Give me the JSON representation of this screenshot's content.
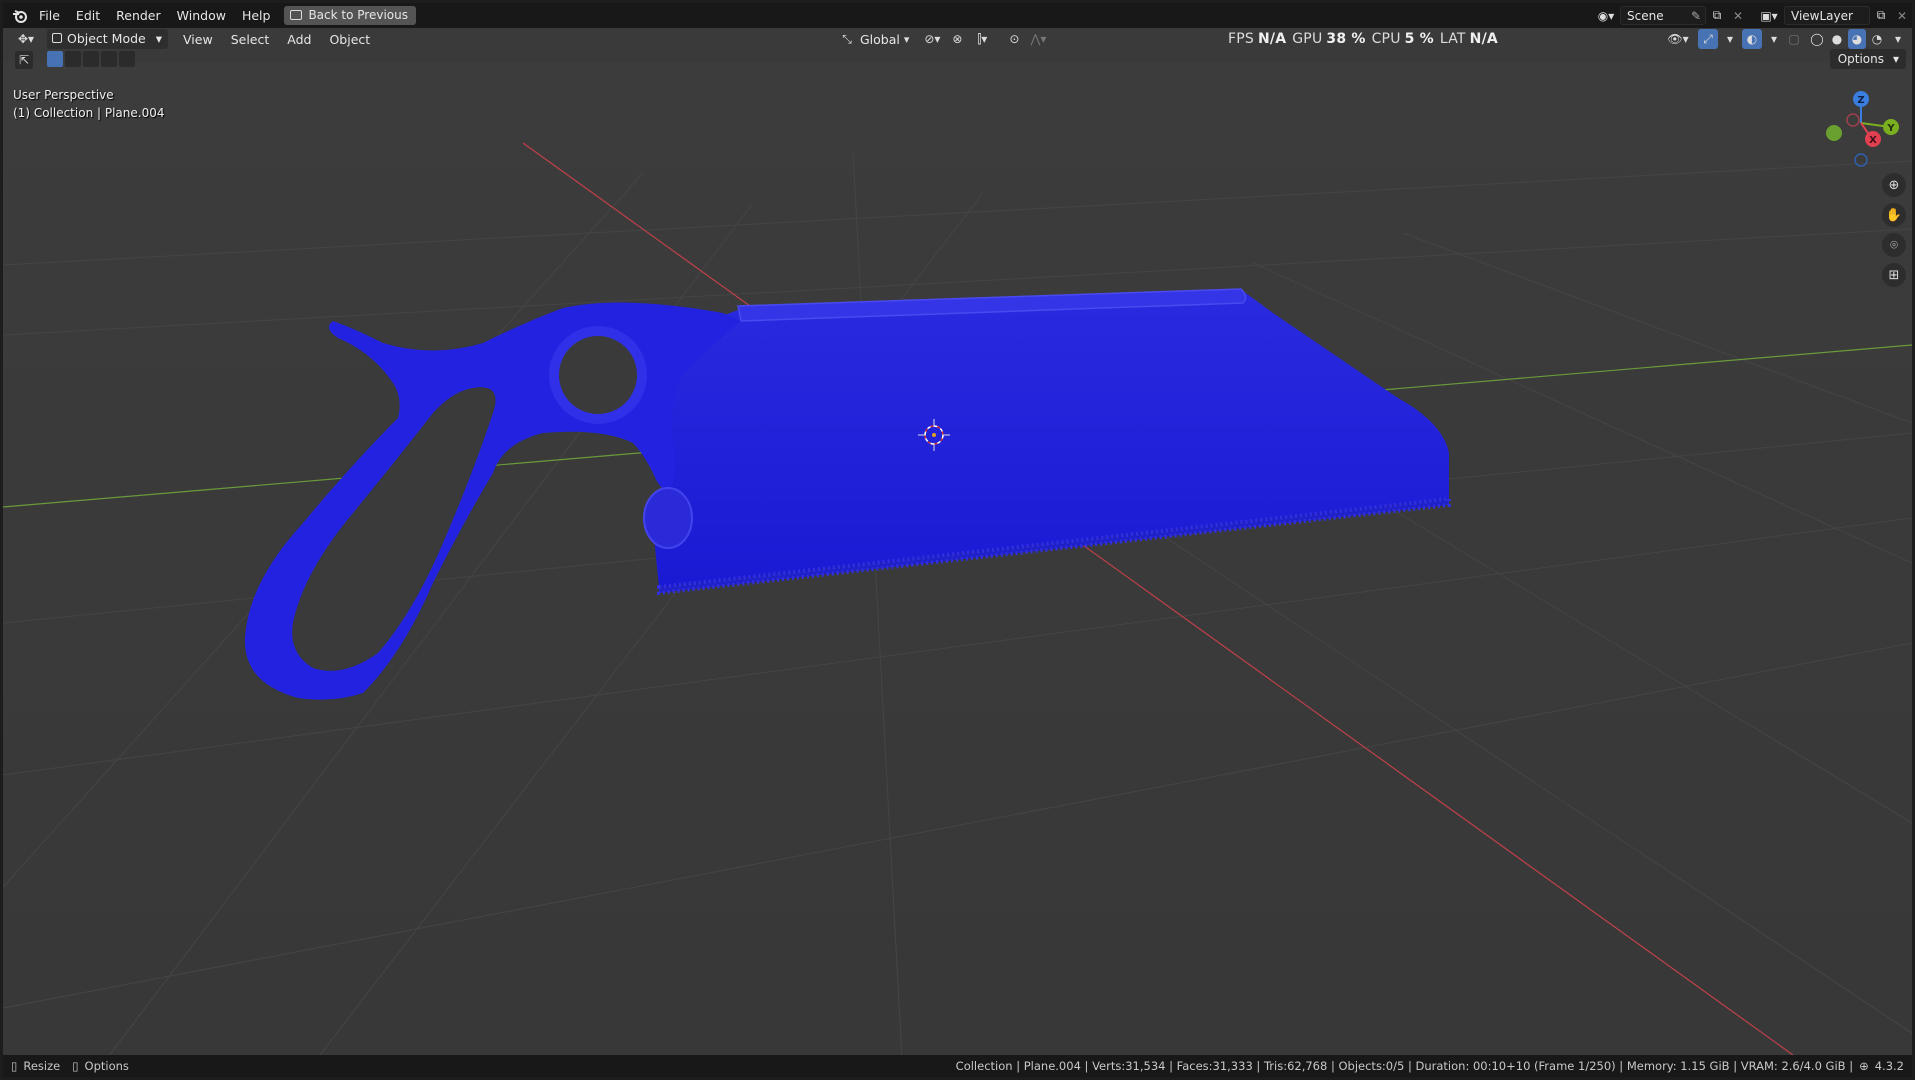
{
  "topbar": {
    "menus": [
      "File",
      "Edit",
      "Render",
      "Window",
      "Help"
    ],
    "back_button": "Back to Previous",
    "scene": "Scene",
    "view_layer": "ViewLayer"
  },
  "header": {
    "mode": "Object Mode",
    "menus": [
      "View",
      "Select",
      "Add",
      "Object"
    ],
    "transform_orientation": "Global"
  },
  "stats": {
    "fps_label": "FPS",
    "fps_value": "N/A",
    "gpu_label": "GPU",
    "gpu_value": "38 %",
    "cpu_label": "CPU",
    "cpu_value": "5 %",
    "lat_label": "LAT",
    "lat_value": "N/A"
  },
  "viewport": {
    "perspective": "User Perspective",
    "collection_info": "(1) Collection | Plane.004",
    "options": "Options",
    "gizmo": {
      "z": "Z",
      "y": "Y",
      "x": "X"
    }
  },
  "statusbar": {
    "resize": "Resize",
    "options": "Options",
    "info": "Collection | Plane.004 | Verts:31,534 | Faces:31,333 | Tris:62,768 | Objects:0/5 | Duration: 00:10+10 (Frame 1/250) | Memory: 1.15 GiB | VRAM: 2.6/4.0 GiB |",
    "version": "4.3.2"
  },
  "colors": {
    "model": "#1f1fe8",
    "grid": "#404040",
    "x_axis": "#c0404a",
    "y_axis": "#6a9a3a"
  }
}
